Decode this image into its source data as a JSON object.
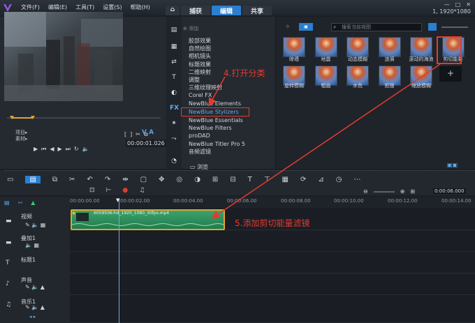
{
  "menu": {
    "items": [
      "文件(F)",
      "编辑(E)",
      "工具(T)",
      "设置(S)",
      "帮助(H)"
    ]
  },
  "tabs": [
    {
      "label": "捕获"
    },
    {
      "label": "编辑"
    },
    {
      "label": "共享"
    }
  ],
  "window": {
    "resolution": "1, 1920*1080"
  },
  "preview": {
    "mode_project": "项目▸",
    "mode_clip": "素材▸",
    "timecode": "00:00:01.026",
    "va_label": "V A"
  },
  "library": {
    "add_label": "添加",
    "search_placeholder": "搜索当前视图",
    "browse_label": "浏览",
    "categories": [
      {
        "label": "胶部效果"
      },
      {
        "label": "自然绘图"
      },
      {
        "label": "相机镜头"
      },
      {
        "label": "标题效果"
      },
      {
        "label": "二维映射"
      },
      {
        "label": "调整"
      },
      {
        "label": "三维纹理映射"
      },
      {
        "label": "Corel FX"
      },
      {
        "label": "NewBlue Elements"
      },
      {
        "label": "NewBlue Stylizers",
        "selected": true
      },
      {
        "label": "NewBlue Essentials"
      },
      {
        "label": "NewBlue Filters"
      },
      {
        "label": "proDAD"
      },
      {
        "label": "NewBlue Titler Pro 5"
      },
      {
        "label": "音频滤镜"
      }
    ],
    "filters_row1": [
      "晾墙",
      "地震",
      "动态模糊",
      "涟漪",
      "滚动的海浪",
      "剪切能量"
    ],
    "filters_row2": [
      "旋转模糊",
      "粗画",
      "水色",
      "抠摆",
      "缩放模糊"
    ]
  },
  "timeline": {
    "ruler": [
      "00:00:00.00",
      "00:00:02.00",
      "00:00:04.00",
      "00:00:06.00",
      "00:00:08.00",
      "00:00:10.00",
      "00:00:12.00",
      "00:00:14.00"
    ],
    "zoom_readout": "0:00:06.000",
    "tracks": [
      {
        "name": "视频"
      },
      {
        "name": "叠加1"
      },
      {
        "name": "标题1"
      },
      {
        "name": "声音"
      },
      {
        "name": "音乐1"
      }
    ],
    "clip_name": "6059506-hd_1920_1080_30fps.mp4"
  },
  "annotations": {
    "step4": "4.打开分类",
    "step5": "5.添加剪切能量滤镜"
  },
  "colors": {
    "accent": "#2a7fd0",
    "annotation": "#e23b2f",
    "clip": "#2f8f5d",
    "clip_border": "#e0a52e",
    "selected_text": "#5dadf0"
  }
}
